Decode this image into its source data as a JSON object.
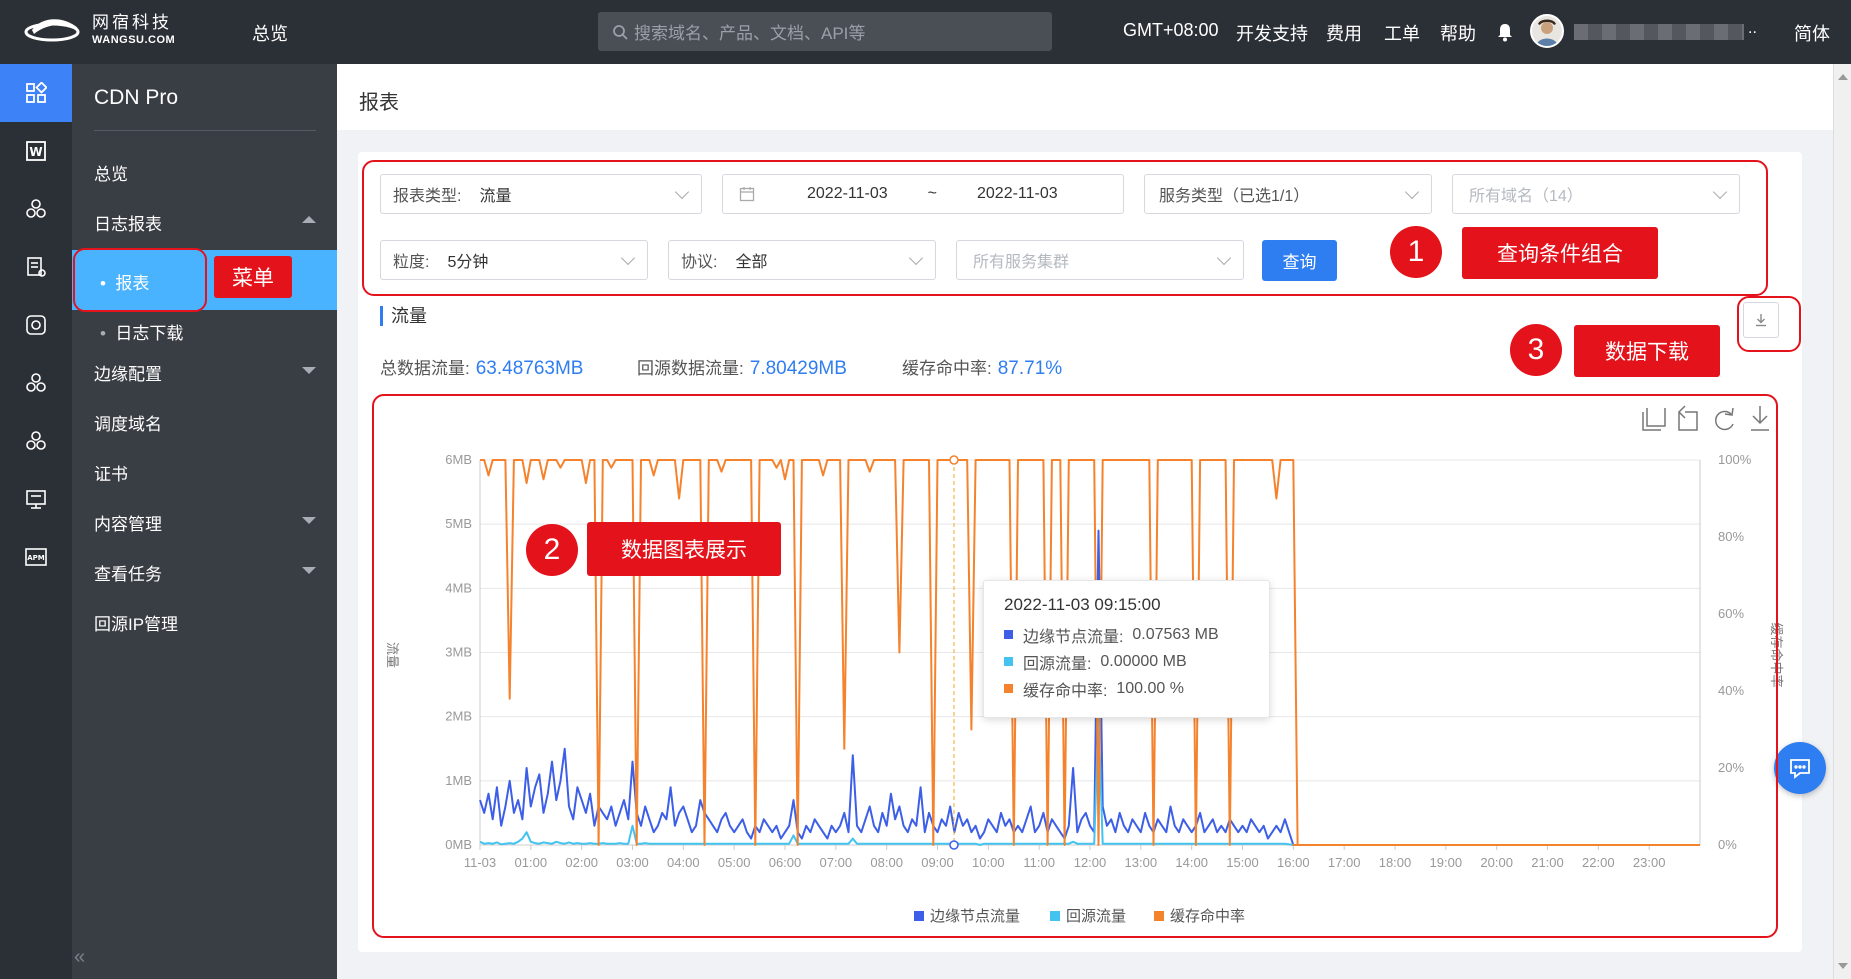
{
  "topbar": {
    "logo_cn": "网宿科技",
    "logo_en": "WANGSU.COM",
    "overview": "总览",
    "search_placeholder": "搜索域名、产品、文档、API等",
    "timezone": "GMT+08:00",
    "dev_support": "开发支持",
    "billing": "费用",
    "ticket": "工单",
    "help": "帮助",
    "account_suffix": "..",
    "language": "简体"
  },
  "sidebar": {
    "product": "CDN Pro",
    "items": {
      "overview": "总览",
      "log_report": "日志报表",
      "report": "报表",
      "log_download": "日志下载",
      "edge_config": "边缘配置",
      "dispatch_domain": "调度域名",
      "certificate": "证书",
      "content_mgmt": "内容管理",
      "view_tasks": "查看任务",
      "origin_ip": "回源IP管理"
    },
    "collapse": "«"
  },
  "page": {
    "title": "报表"
  },
  "filters": {
    "report_type_label": "报表类型:",
    "report_type_value": "流量",
    "date_start": "2022-11-03",
    "date_sep": "~",
    "date_end": "2022-11-03",
    "service_type": "服务类型（已选1/1）",
    "domains_placeholder": "所有域名（14）",
    "granularity_label": "粒度:",
    "granularity_value": "5分钟",
    "protocol_label": "协议:",
    "protocol_value": "全部",
    "clusters_placeholder": "所有服务集群",
    "query_button": "查询"
  },
  "annotations": {
    "menu": "菜单",
    "n1": "1",
    "query_combo": "查询条件组合",
    "n2": "2",
    "chart_display": "数据图表展示",
    "n3": "3",
    "data_download": "数据下载"
  },
  "summary": {
    "section_title": "流量",
    "total_label": "总数据流量:",
    "total_value": "63.48763MB",
    "origin_label": "回源数据流量:",
    "origin_value": "7.80429MB",
    "hit_label": "缓存命中率:",
    "hit_value": "87.71%"
  },
  "tooltip": {
    "time": "2022-11-03 09:15:00",
    "edge_label": "边缘节点流量:",
    "edge_value": "0.07563 MB",
    "origin_label": "回源流量:",
    "origin_value": "0.00000 MB",
    "hit_label": "缓存命中率:",
    "hit_value": "100.00 %"
  },
  "colors": {
    "edge": "#3d5fe8",
    "origin": "#42c3f0",
    "hit": "#f5822d",
    "accent": "#2f7ef1",
    "annotation_red": "#e4121b"
  },
  "chart_data": {
    "type": "line",
    "ylabel_left": "流量",
    "ylabel_right": "缓存命中率",
    "y_left_ticks": [
      "0MB",
      "1MB",
      "2MB",
      "3MB",
      "4MB",
      "5MB",
      "6MB"
    ],
    "y_right_ticks": [
      "0%",
      "20%",
      "40%",
      "60%",
      "80%",
      "100%"
    ],
    "ylim_left_mb": [
      0,
      6
    ],
    "ylim_right_pct": [
      0,
      100
    ],
    "x_ticks": [
      "11-03",
      "01:00",
      "02:00",
      "03:00",
      "04:00",
      "05:00",
      "06:00",
      "07:00",
      "08:00",
      "09:00",
      "10:00",
      "11:00",
      "12:00",
      "13:00",
      "14:00",
      "15:00",
      "16:00",
      "17:00",
      "18:00",
      "19:00",
      "20:00",
      "21:00",
      "22:00",
      "23:00"
    ],
    "legend": [
      "边缘节点流量",
      "回源流量",
      "缓存命中率"
    ],
    "legend_position": "bottom",
    "interval_minutes": 5,
    "data_end_time": "16:00",
    "series": [
      {
        "name": "边缘节点流量",
        "unit": "MB",
        "values": [
          0.7,
          0.5,
          0.8,
          0.4,
          0.9,
          0.3,
          0.6,
          1.0,
          0.5,
          0.7,
          0.4,
          1.2,
          0.6,
          0.9,
          1.1,
          0.5,
          0.8,
          1.3,
          0.7,
          1.0,
          1.5,
          0.6,
          0.4,
          0.9,
          0.7,
          0.5,
          0.8,
          0.3,
          0.6,
          0.5,
          0.4,
          0.6,
          0.3,
          0.5,
          0.7,
          0.4,
          1.3,
          0.5,
          0.3,
          0.6,
          0.4,
          0.2,
          0.3,
          0.5,
          0.4,
          0.9,
          0.3,
          0.5,
          0.6,
          0.4,
          0.2,
          0.3,
          0.7,
          0.5,
          0.4,
          0.3,
          0.2,
          0.4,
          0.5,
          0.3,
          0.2,
          0.3,
          0.4,
          0.2,
          0.1,
          0.3,
          0.2,
          0.4,
          0.3,
          0.2,
          0.3,
          0.1,
          0.2,
          0.3,
          0.7,
          0.2,
          0.1,
          0.3,
          0.2,
          0.4,
          0.3,
          0.2,
          0.1,
          0.3,
          0.2,
          0.3,
          0.5,
          0.2,
          1.4,
          0.3,
          0.2,
          0.4,
          0.6,
          0.3,
          0.2,
          0.5,
          0.3,
          0.8,
          0.4,
          0.6,
          0.3,
          0.2,
          0.4,
          0.3,
          0.9,
          0.2,
          0.5,
          0.3,
          0.2,
          0.4,
          0.3,
          0.6,
          0.2,
          0.5,
          0.3,
          0.4,
          0.2,
          0.3,
          0.1,
          0.2,
          0.4,
          0.3,
          0.2,
          0.5,
          0.3,
          0.4,
          0.2,
          0.3,
          0.2,
          0.4,
          0.6,
          0.2,
          0.3,
          0.5,
          0.2,
          0.4,
          0.3,
          0.2,
          0.1,
          0.3,
          1.2,
          0.2,
          0.4,
          0.5,
          0.3,
          0.2,
          4.9,
          0.6,
          0.3,
          0.4,
          0.2,
          0.5,
          0.3,
          0.2,
          0.4,
          0.3,
          0.2,
          0.5,
          0.3,
          0.2,
          0.4,
          0.3,
          0.2,
          0.6,
          0.3,
          0.2,
          0.4,
          0.3,
          0.2,
          0.3,
          0.5,
          0.2,
          0.3,
          0.4,
          0.2,
          0.3,
          0.2,
          0.4,
          0.3,
          0.2,
          0.3,
          0.2,
          0.4,
          0.3,
          0.2,
          0.3,
          0.1,
          0.2,
          0.3,
          0.2,
          0.4
        ]
      },
      {
        "name": "回源流量",
        "unit": "MB",
        "values": [
          0.05,
          0.02,
          0.03,
          0.02,
          0.04,
          0.01,
          0.02,
          0.03,
          0.02,
          0.05,
          0.1,
          0.2,
          0.05,
          0.03,
          0.02,
          0.04,
          0.03,
          0.02,
          0.05,
          0.03,
          0.02,
          0.04,
          0.02,
          0.03,
          0.02,
          0.02,
          0.03,
          0.02,
          0.02,
          0.03,
          0.02,
          0.02,
          0.02,
          0.03,
          0.02,
          0.02,
          0.3,
          0.02,
          0.02,
          0.03,
          0.02,
          0.02,
          0.02,
          0.02,
          0.02,
          0.02,
          0.02,
          0.02,
          0.02,
          0.02,
          0.02,
          0.02,
          0.02,
          0.02,
          0.02,
          0.02,
          0.02,
          0.02,
          0.02,
          0.02,
          0.02,
          0.02,
          0.02,
          0.02,
          0.02,
          0.02,
          0.02,
          0.02,
          0.02,
          0.02,
          0.02,
          0.02,
          0.02,
          0.02,
          0.15,
          0.02,
          0.02,
          0.02,
          0.02,
          0.02,
          0.02,
          0.02,
          0.02,
          0.02,
          0.02,
          0.02,
          0.02,
          0.02,
          0.1,
          0.02,
          0.02,
          0.02,
          0.02,
          0.02,
          0.02,
          0.02,
          0.02,
          0.02,
          0.02,
          0.02,
          0.02,
          0.02,
          0.02,
          0.02,
          0.02,
          0.02,
          0.02,
          0.02,
          0.02,
          0.02,
          0.02,
          0.02,
          0.02,
          0.02,
          0.02,
          0.02,
          0.02,
          0.02,
          0.0,
          0.02,
          0.02,
          0.02,
          0.02,
          0.02,
          0.02,
          0.02,
          0.02,
          0.02,
          0.02,
          0.02,
          0.02,
          0.02,
          0.02,
          0.02,
          0.02,
          0.02,
          0.02,
          0.02,
          0.02,
          0.02,
          0.05,
          0.02,
          0.02,
          0.02,
          0.02,
          0.02,
          2.0,
          0.02,
          0.02,
          0.02,
          0.02,
          0.02,
          0.02,
          0.02,
          0.02,
          0.02,
          0.02,
          0.02,
          0.02,
          0.02,
          0.02,
          0.02,
          0.02,
          0.02,
          0.02,
          0.02,
          0.02,
          0.02,
          0.02,
          0.02,
          0.02,
          0.02,
          0.02,
          0.02,
          0.02,
          0.02,
          0.02,
          0.02,
          0.02,
          0.02,
          0.02,
          0.02,
          0.02,
          0.02,
          0.02,
          0.02,
          0.02,
          0.02,
          0.02,
          0.02,
          0.02
        ]
      },
      {
        "name": "缓存命中率",
        "unit": "%",
        "values": [
          100,
          100,
          96,
          100,
          100,
          100,
          100,
          38,
          100,
          100,
          100,
          94,
          100,
          100,
          100,
          95,
          100,
          100,
          100,
          98,
          100,
          100,
          100,
          100,
          100,
          94,
          100,
          100,
          0,
          100,
          100,
          98,
          100,
          100,
          100,
          100,
          100,
          0,
          100,
          100,
          100,
          96,
          100,
          100,
          100,
          100,
          100,
          90,
          100,
          100,
          100,
          100,
          100,
          0,
          100,
          100,
          100,
          97,
          100,
          100,
          100,
          100,
          100,
          100,
          100,
          0,
          100,
          100,
          100,
          100,
          98,
          100,
          95,
          100,
          100,
          0,
          100,
          100,
          100,
          100,
          100,
          96,
          100,
          100,
          100,
          100,
          25,
          100,
          100,
          100,
          100,
          100,
          97,
          100,
          100,
          100,
          100,
          100,
          100,
          50,
          100,
          100,
          100,
          100,
          100,
          100,
          100,
          0,
          100,
          100,
          100,
          100,
          100,
          100,
          100,
          100,
          30,
          100,
          100,
          100,
          100,
          100,
          100,
          100,
          100,
          100,
          0,
          100,
          100,
          100,
          100,
          100,
          100,
          100,
          0,
          100,
          100,
          100,
          0,
          100,
          100,
          100,
          100,
          100,
          100,
          100,
          0,
          100,
          100,
          100,
          100,
          100,
          100,
          100,
          100,
          100,
          100,
          100,
          100,
          0,
          100,
          100,
          100,
          100,
          100,
          100,
          100,
          100,
          100,
          0,
          100,
          100,
          100,
          100,
          100,
          100,
          100,
          0,
          100,
          100,
          100,
          100,
          100,
          100,
          100,
          100,
          100,
          100,
          90,
          100,
          100,
          100,
          100,
          0,
          0
        ]
      }
    ]
  }
}
